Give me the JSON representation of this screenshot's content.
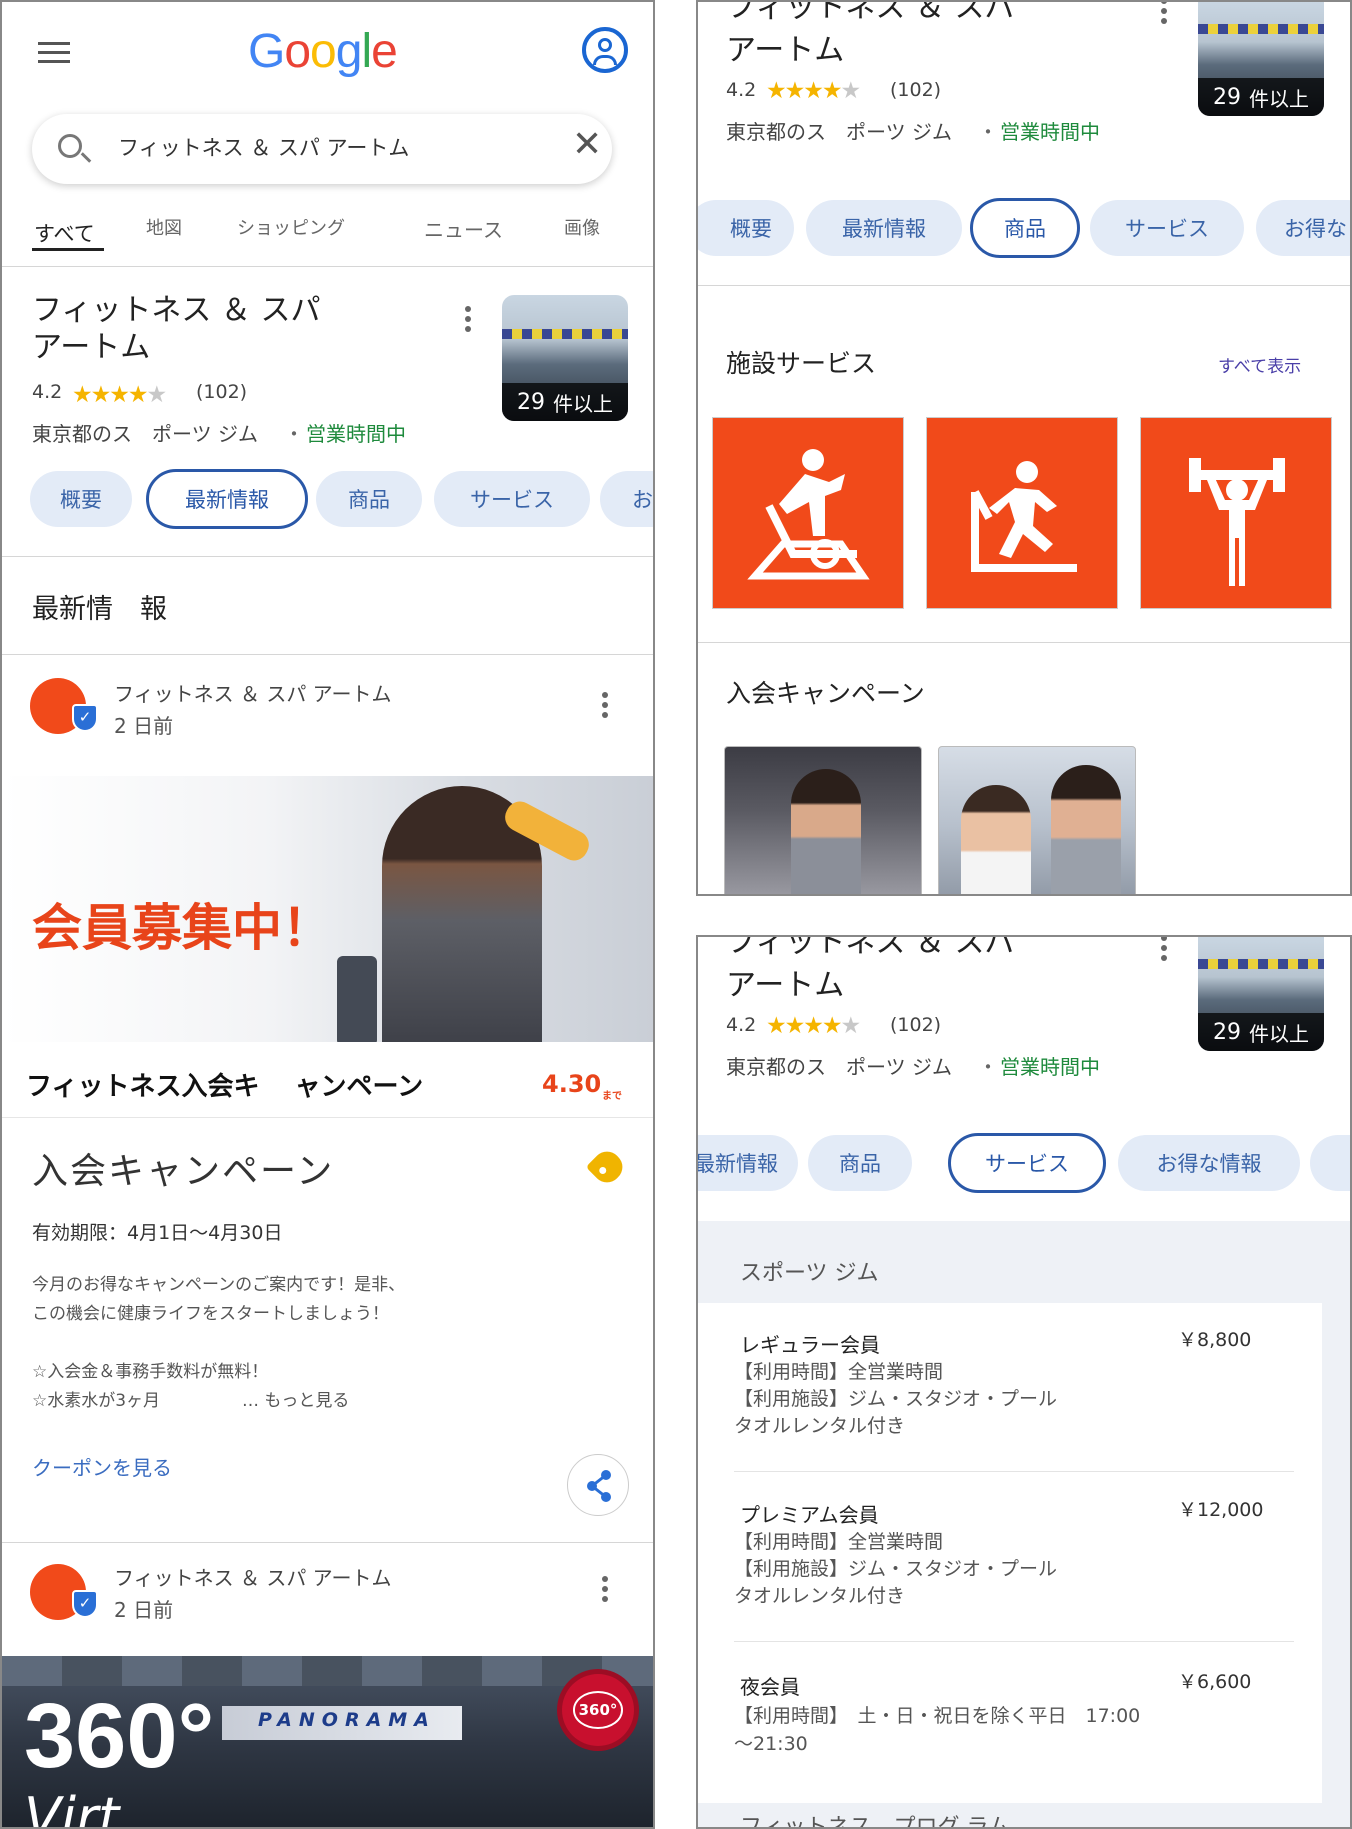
{
  "left": {
    "logo": "Google",
    "search": {
      "value": "フィットネス ＆ スパ アートム"
    },
    "tabs": [
      "すべて",
      "地図",
      "ショッピング",
      "ニュース",
      "画像"
    ],
    "business": {
      "name_line1": "フィットネス ＆ スパ",
      "name_line2": "アートム",
      "rating": "4.2",
      "stars": 4.2,
      "reviews": "(102)",
      "category": "東京都のス　ポーツ ジム",
      "sep": "・",
      "open": "営業時間中",
      "photo_count": "29",
      "photo_suffix": "件以上"
    },
    "chips": [
      "概要",
      "最新情報",
      "商品",
      "サービス",
      "お得"
    ],
    "section_title": "最新情　報",
    "post1": {
      "author": "フィットネス ＆ スパ アートム",
      "time": "2 日前"
    },
    "banner": {
      "headline": "会員募集中！",
      "caption": "フィットネス入会キ　 ャンペーン",
      "date": "4.30",
      "date_suffix": "まで"
    },
    "offer": {
      "title": "入会キャンペーン",
      "validity": "有効期限：4月1日〜4月30日",
      "body1": "今月のお得なキャンペーンのご案内です！是非、",
      "body2": "この機会に健康ライフをスタートしましょう！",
      "bullet1": "☆入会金＆事務手数料が無料！",
      "bullet2": "☆水素水が3ヶ月",
      "more": "… もっと見る",
      "coupon": "クーポンを見る"
    },
    "post2": {
      "author": "フィットネス ＆ スパ アートム",
      "time": "2 日前"
    },
    "panorama": {
      "big": "360°",
      "label": "PANORAMA",
      "sub": "Virt",
      "badge": "360°"
    }
  },
  "right_top": {
    "name_line1": "フィットネス ＆ スパ",
    "name_line2": "アートム",
    "rating": "4.2",
    "reviews": "(102)",
    "category": "東京都のス　ポーツ ジム",
    "sep": "・",
    "open": "営業時間中",
    "photo_count": "29",
    "photo_suffix": "件以上",
    "chips": [
      "概要",
      "最新情報",
      "商品",
      "サービス",
      "お得な"
    ],
    "facility_title": "施設サービス",
    "show_all": "すべて表示",
    "campaign_title": "入会キャンペーン"
  },
  "right_bottom": {
    "name_line1": "フィットネス ＆ スパ",
    "name_line2": "アートム",
    "rating": "4.2",
    "reviews": "(102)",
    "category": "東京都のス　ポーツ ジム",
    "sep": "・",
    "open": "営業時間中",
    "photo_count": "29",
    "photo_suffix": "件以上",
    "chips": [
      "最新情報",
      "商品",
      "サービス",
      "お得な情報",
      ""
    ],
    "section": "スポーツ ジム",
    "items": [
      {
        "name": "レギュラー会員",
        "price": "￥8,800",
        "l1": "【利用時間】全営業時間",
        "l2": "【利用施設】ジム・スタジオ・プール",
        "l3": "タオルレンタル付き"
      },
      {
        "name": "プレミアム会員",
        "price": "￥12,000",
        "l1": "【利用時間】全営業時間",
        "l2": "【利用施設】ジム・スタジオ・プール",
        "l3": "タオルレンタル付き"
      },
      {
        "name": "夜会員",
        "price": "￥6,600",
        "l1": "【利用時間】　土・日・祝日を除く平日　17:00",
        "l2": "〜21:30",
        "l3": ""
      }
    ],
    "next_section": "フィットネス　プログ ラム"
  },
  "colors": {
    "accent": "#2a58a8",
    "orange": "#f14a1a",
    "green": "#1e8a3c",
    "star": "#f5b400"
  }
}
